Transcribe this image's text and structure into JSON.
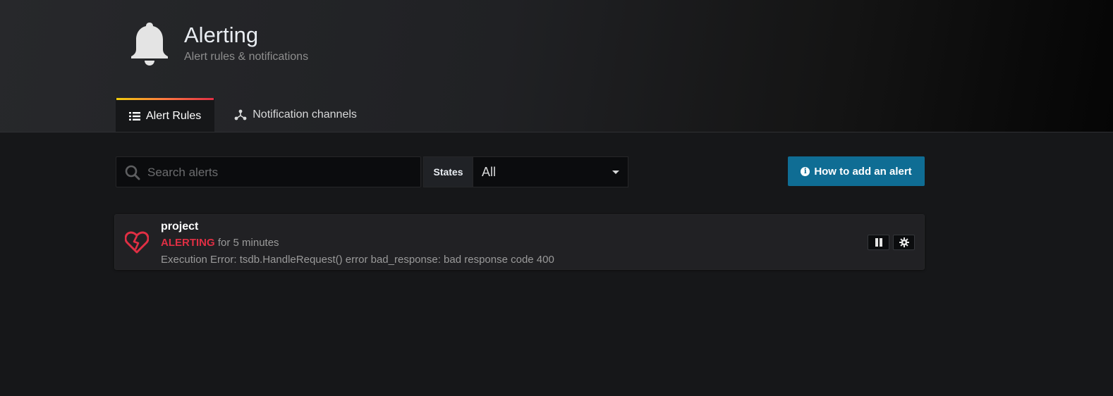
{
  "header": {
    "title": "Alerting",
    "subtitle": "Alert rules & notifications",
    "icon": "bell-icon"
  },
  "tabs": [
    {
      "label": "Alert Rules",
      "icon": "list-icon",
      "active": true
    },
    {
      "label": "Notification channels",
      "icon": "share-nodes-icon",
      "active": false
    }
  ],
  "toolbar": {
    "search_placeholder": "Search alerts",
    "search_value": "",
    "states_label": "States",
    "states_selected": "All",
    "help_button_label": "How to add an alert"
  },
  "alerts": [
    {
      "name": "project",
      "state": "ALERTING",
      "state_duration": "for 5 minutes",
      "info": "Execution Error: tsdb.HandleRequest() error bad_response: bad response code 400",
      "icon": "broken-heart-icon"
    }
  ],
  "colors": {
    "alerting": "#e02f44",
    "primary_button": "#0f6d94",
    "background": "#161719",
    "card_background": "#212124"
  }
}
